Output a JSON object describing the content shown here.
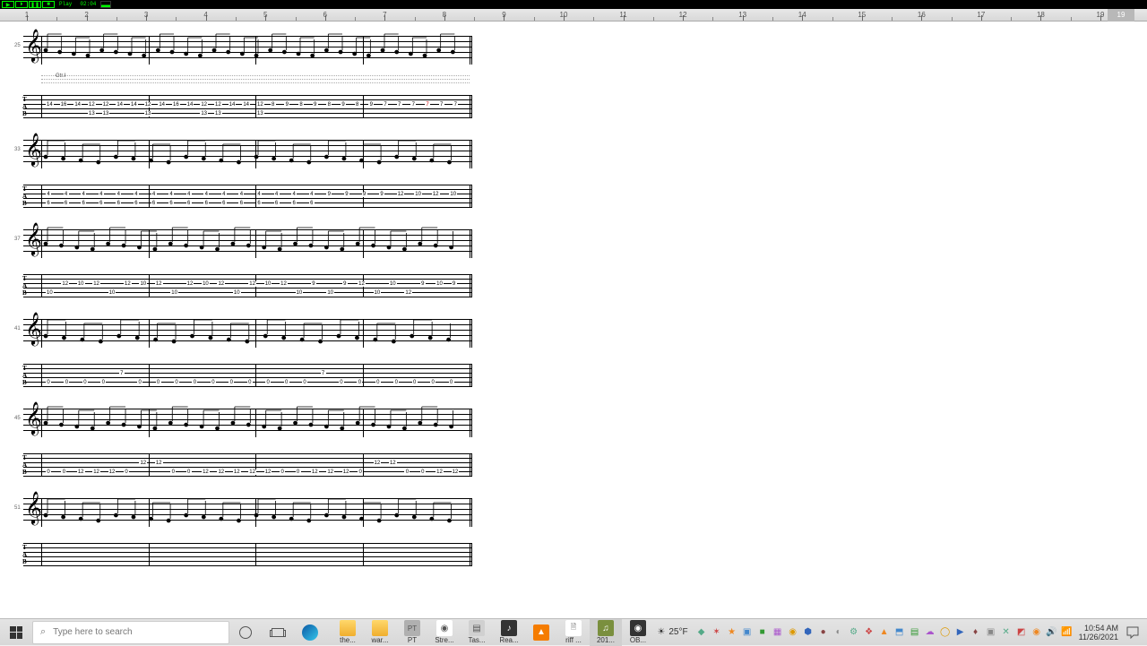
{
  "transport": {
    "mode_label": "Play",
    "time_display": "02:04"
  },
  "ruler": {
    "marks": [
      "1",
      "2",
      "3",
      "4",
      "5",
      "6",
      "7",
      "8",
      "9",
      "10",
      "11",
      "12",
      "13",
      "14",
      "15",
      "16",
      "17",
      "18",
      "19"
    ],
    "playhead": "19"
  },
  "score": {
    "marker": "Gtr.I",
    "systems": [
      {
        "measure_start": 25,
        "tab_rows": [
          [
            "14",
            "16",
            "14",
            "12",
            "12",
            "14",
            "14",
            "12",
            "14",
            "16",
            "14",
            "12",
            "12",
            "14",
            "14",
            "12",
            "8",
            "9",
            "8",
            "9",
            "8",
            "9",
            "8",
            "9",
            "7",
            "7",
            "7",
            "7",
            "7",
            "7"
          ],
          [
            "",
            "",
            "",
            "13",
            "13",
            "",
            "",
            "13",
            "",
            "",
            "",
            "13",
            "13",
            "",
            "",
            "13",
            "",
            "",
            "",
            "",
            "",
            "",
            "",
            "",
            "",
            "",
            "",
            "",
            "",
            ""
          ]
        ],
        "highlight_idx": 27
      },
      {
        "measure_start": 33,
        "tab_rows": [
          [
            "4",
            "4",
            "4",
            "4",
            "4",
            "4",
            "4",
            "4",
            "4",
            "4",
            "4",
            "4",
            "4",
            "4",
            "4",
            "4",
            "9",
            "9",
            "9",
            "9",
            "12",
            "10",
            "12",
            "10"
          ],
          [
            "6",
            "6",
            "6",
            "6",
            "6",
            "6",
            "6",
            "6",
            "6",
            "6",
            "6",
            "6",
            "6",
            "6",
            "6",
            "6",
            "",
            "",
            "",
            "",
            "",
            "",
            "",
            ""
          ]
        ]
      },
      {
        "measure_start": 37,
        "tab_rows": [
          [
            "",
            "12",
            "10",
            "12",
            "",
            "12",
            "10",
            "12",
            "",
            "12",
            "10",
            "12",
            "",
            "12",
            "10",
            "12",
            "",
            "9",
            "",
            "9",
            "12",
            "",
            "10",
            "",
            "9",
            "10",
            "9"
          ],
          [
            "10",
            "",
            "",
            "",
            "10",
            "",
            "",
            "",
            "10",
            "",
            "",
            "",
            "10",
            "",
            "",
            "",
            "10",
            "",
            "10",
            "",
            "",
            "10",
            "",
            "12",
            "",
            "",
            ""
          ]
        ]
      },
      {
        "measure_start": 41,
        "tab_rows": [
          [
            "",
            "",
            "",
            "",
            "7",
            "",
            "",
            "",
            "",
            "",
            "",
            "",
            "",
            "",
            "",
            "7",
            "",
            "",
            "",
            "",
            "",
            "",
            ""
          ],
          [
            "0",
            "0",
            "0",
            "0",
            "",
            "0",
            "0",
            "0",
            "0",
            "0",
            "0",
            "0",
            "0",
            "0",
            "0",
            "",
            "0",
            "0",
            "0",
            "0",
            "0",
            "0",
            "0"
          ]
        ]
      },
      {
        "measure_start": 45,
        "tab_rows": [
          [
            "",
            "",
            "",
            "",
            "",
            "",
            "12",
            "12",
            "",
            "",
            "",
            "",
            "",
            "",
            "",
            "",
            "",
            "",
            "",
            "",
            "",
            "12",
            "12",
            "",
            "",
            "",
            ""
          ],
          [
            "0",
            "0",
            "12",
            "12",
            "12",
            "0",
            "",
            "",
            "0",
            "0",
            "12",
            "12",
            "12",
            "12",
            "12",
            "0",
            "0",
            "12",
            "12",
            "12",
            "0",
            "",
            "",
            "0",
            "0",
            "12",
            "12"
          ]
        ]
      },
      {
        "measure_start": 51,
        "tab_rows": []
      }
    ],
    "tab_letters": [
      "T",
      "A",
      "B"
    ]
  },
  "taskbar": {
    "search_placeholder": "Type here to search",
    "weather": {
      "temp": "25°F",
      "icon": "☀"
    },
    "apps": [
      {
        "name": "the...",
        "color": "#f0ae2e",
        "type": "folder"
      },
      {
        "name": "war...",
        "color": "#f0ae2e",
        "type": "folder"
      },
      {
        "name": "PT",
        "color": "#b0b0b0",
        "glyph": "PT"
      },
      {
        "name": "Stre...",
        "color": "#fff",
        "glyph": "◉"
      },
      {
        "name": "Tas...",
        "color": "#d0d0d0",
        "glyph": "▤"
      },
      {
        "name": "Rea...",
        "color": "#333",
        "glyph": "♪"
      },
      {
        "name": "",
        "color": "#f57c00",
        "glyph": "▲"
      },
      {
        "name": "riff ...",
        "color": "#fff",
        "glyph": "🗎"
      },
      {
        "name": "201...",
        "color": "#7a8f3e",
        "glyph": "♫"
      },
      {
        "name": "OB...",
        "color": "#333",
        "glyph": "◉"
      }
    ],
    "tray_icons": [
      "◆",
      "✶",
      "★",
      "▣",
      "■",
      "▦",
      "◉",
      "⬢",
      "●",
      "◐",
      "⚙",
      "❖",
      "▲",
      "⬒",
      "▤",
      "☁",
      "◯",
      "▶",
      "♦",
      "▣",
      "✕",
      "◩",
      "◉",
      "🔊",
      "📶"
    ],
    "clock": {
      "time": "10:54 AM",
      "date": "11/26/2021"
    }
  },
  "colors": {
    "terminal_green": "#00ff00",
    "highlight_red": "#cc0000"
  }
}
